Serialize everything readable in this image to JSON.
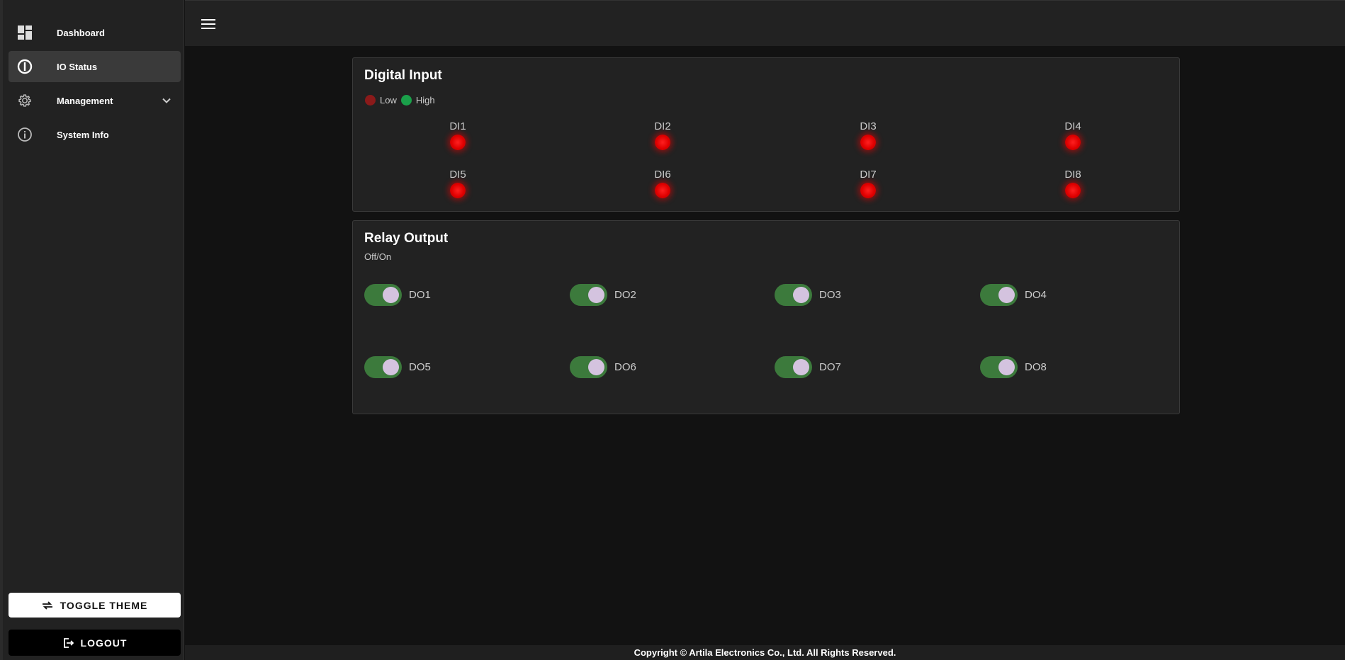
{
  "sidebar": {
    "items": [
      {
        "label": "Dashboard",
        "icon": "dashboard-icon"
      },
      {
        "label": "IO Status",
        "icon": "io-status-icon"
      },
      {
        "label": "Management",
        "icon": "gear-icon"
      },
      {
        "label": "System Info",
        "icon": "info-icon"
      }
    ],
    "toggle_theme_label": "TOGGLE THEME",
    "logout_label": "LOGOUT"
  },
  "digital_input": {
    "title": "Digital Input",
    "legend_low": "Low",
    "legend_high": "High",
    "low_color": "#8b1a1a",
    "high_color": "#1aa04a",
    "inputs": [
      {
        "label": "DI1",
        "state": "low"
      },
      {
        "label": "DI2",
        "state": "low"
      },
      {
        "label": "DI3",
        "state": "low"
      },
      {
        "label": "DI4",
        "state": "low"
      },
      {
        "label": "DI5",
        "state": "low"
      },
      {
        "label": "DI6",
        "state": "low"
      },
      {
        "label": "DI7",
        "state": "low"
      },
      {
        "label": "DI8",
        "state": "low"
      }
    ]
  },
  "relay_output": {
    "title": "Relay Output",
    "subtitle": "Off/On",
    "outputs": [
      {
        "label": "DO1",
        "on": true
      },
      {
        "label": "DO2",
        "on": true
      },
      {
        "label": "DO3",
        "on": true
      },
      {
        "label": "DO4",
        "on": true
      },
      {
        "label": "DO5",
        "on": true
      },
      {
        "label": "DO6",
        "on": true
      },
      {
        "label": "DO7",
        "on": true
      },
      {
        "label": "DO8",
        "on": true
      }
    ]
  },
  "footer": {
    "copyright": "Copyright © Artila Electronics Co., Ltd. All Rights Reserved."
  }
}
